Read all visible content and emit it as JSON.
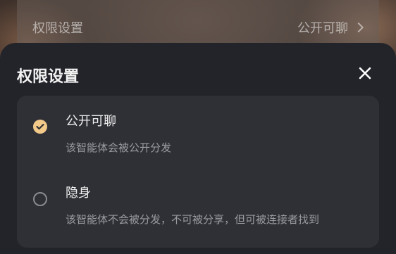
{
  "background_row": {
    "label": "权限设置",
    "value": "公开可聊"
  },
  "sheet": {
    "title": "权限设置",
    "close_icon": "close-icon"
  },
  "options": [
    {
      "title": "公开可聊",
      "description": "该智能体会被公开分发",
      "selected": true
    },
    {
      "title": "隐身",
      "description": "该智能体不会被分发，不可被分享，但可被连接者找到",
      "selected": false
    }
  ],
  "colors": {
    "accent": "#f3c98a",
    "sheet_bg": "#23242a",
    "card_bg": "#2f3036"
  }
}
